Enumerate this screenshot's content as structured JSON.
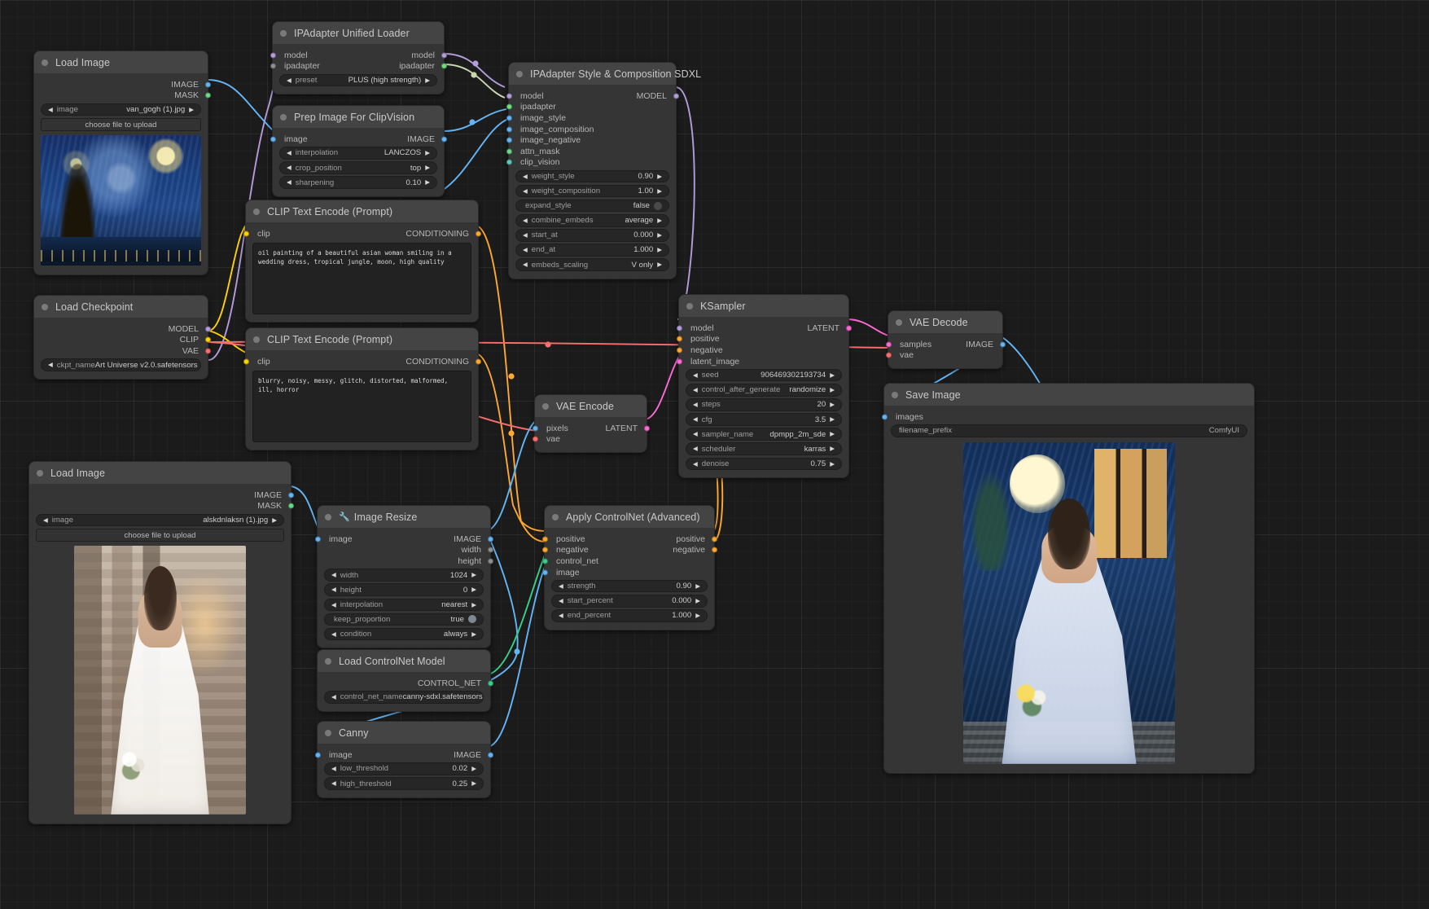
{
  "app": "ComfyUI node graph",
  "colors": {
    "node_bg": "#353535",
    "node_title_bg": "#444444",
    "link_model": "#b39ddb",
    "link_cond": "#ffa931",
    "link_image": "#64b5f6",
    "link_latent": "#ff6bd6",
    "link_vae": "#ff6e6e",
    "link_clip": "#ffd500",
    "link_controlnet": "#39d18a",
    "link_ipadapter": "#c9d6b0"
  },
  "nodes": {
    "load_image_style": {
      "title": "Load Image",
      "outputs": [
        "IMAGE",
        "MASK"
      ],
      "widgets": [
        {
          "name": "image",
          "value": "van_gogh (1).jpg",
          "arrows": true
        }
      ],
      "button": "choose file to upload",
      "preview_alt": "starry night style reference"
    },
    "ipadapter_loader": {
      "title": "IPAdapter Unified Loader",
      "inputs": [
        "model",
        "ipadapter"
      ],
      "outputs": [
        "model",
        "ipadapter"
      ],
      "widgets": [
        {
          "name": "preset",
          "value": "PLUS (high strength)",
          "arrows": true
        }
      ]
    },
    "prep_clipvision": {
      "title": "Prep Image For ClipVision",
      "inputs": [
        "image"
      ],
      "outputs": [
        "IMAGE"
      ],
      "widgets": [
        {
          "name": "interpolation",
          "value": "LANCZOS",
          "arrows": true
        },
        {
          "name": "crop_position",
          "value": "top",
          "arrows": true
        },
        {
          "name": "sharpening",
          "value": "0.10",
          "arrows": true
        }
      ]
    },
    "ipadapter_style_comp": {
      "title": "IPAdapter Style & Composition SDXL",
      "inputs": [
        "model",
        "ipadapter",
        "image_style",
        "image_composition",
        "image_negative",
        "attn_mask",
        "clip_vision"
      ],
      "outputs": [
        "MODEL"
      ],
      "widgets": [
        {
          "name": "weight_style",
          "value": "0.90",
          "arrows": true
        },
        {
          "name": "weight_composition",
          "value": "1.00",
          "arrows": true
        },
        {
          "name": "expand_style",
          "value": "false",
          "arrows": false,
          "toggle": true
        },
        {
          "name": "combine_embeds",
          "value": "average",
          "arrows": true
        },
        {
          "name": "start_at",
          "value": "0.000",
          "arrows": true
        },
        {
          "name": "end_at",
          "value": "1.000",
          "arrows": true
        },
        {
          "name": "embeds_scaling",
          "value": "V only",
          "arrows": true
        }
      ]
    },
    "clip_positive": {
      "title": "CLIP Text Encode (Prompt)",
      "inputs": [
        "clip"
      ],
      "outputs": [
        "CONDITIONING"
      ],
      "text": "oil painting of a beautiful asian woman smiling in a wedding dress, tropical jungle, moon, high quality"
    },
    "clip_negative": {
      "title": "CLIP Text Encode (Prompt)",
      "inputs": [
        "clip"
      ],
      "outputs": [
        "CONDITIONING"
      ],
      "text": "blurry, noisy, messy, glitch, distorted, malformed, ill, horror"
    },
    "load_checkpoint": {
      "title": "Load Checkpoint",
      "outputs": [
        "MODEL",
        "CLIP",
        "VAE"
      ],
      "widgets": [
        {
          "name": "ckpt_name",
          "value": "Art Universe v2.0.safetensors",
          "arrows": true
        }
      ]
    },
    "load_image_subject": {
      "title": "Load Image",
      "outputs": [
        "IMAGE",
        "MASK"
      ],
      "widgets": [
        {
          "name": "image",
          "value": "alskdnlaksn (1).jpg",
          "arrows": true
        }
      ],
      "button": "choose file to upload",
      "preview_alt": "bride photo reference"
    },
    "image_resize": {
      "title": "Image Resize",
      "icon": "wrench-icon",
      "inputs": [
        "image"
      ],
      "outputs": [
        "IMAGE",
        "width",
        "height"
      ],
      "widgets": [
        {
          "name": "width",
          "value": "1024",
          "arrows": true
        },
        {
          "name": "height",
          "value": "0",
          "arrows": true
        },
        {
          "name": "interpolation",
          "value": "nearest",
          "arrows": true
        },
        {
          "name": "keep_proportion",
          "value": "true",
          "arrows": false,
          "toggle": true
        },
        {
          "name": "condition",
          "value": "always",
          "arrows": true
        }
      ]
    },
    "vae_encode": {
      "title": "VAE Encode",
      "inputs": [
        "pixels",
        "vae"
      ],
      "outputs": [
        "LATENT"
      ]
    },
    "apply_controlnet": {
      "title": "Apply ControlNet (Advanced)",
      "inputs": [
        "positive",
        "negative",
        "control_net",
        "image"
      ],
      "outputs": [
        "positive",
        "negative"
      ],
      "widgets": [
        {
          "name": "strength",
          "value": "0.90",
          "arrows": true
        },
        {
          "name": "start_percent",
          "value": "0.000",
          "arrows": true
        },
        {
          "name": "end_percent",
          "value": "1.000",
          "arrows": true
        }
      ]
    },
    "load_controlnet": {
      "title": "Load ControlNet Model",
      "outputs": [
        "CONTROL_NET"
      ],
      "widgets": [
        {
          "name": "control_net_name",
          "value": "canny-sdxl.safetensors",
          "arrows": true
        }
      ]
    },
    "canny": {
      "title": "Canny",
      "inputs": [
        "image"
      ],
      "outputs": [
        "IMAGE"
      ],
      "widgets": [
        {
          "name": "low_threshold",
          "value": "0.02",
          "arrows": true
        },
        {
          "name": "high_threshold",
          "value": "0.25",
          "arrows": true
        }
      ]
    },
    "ksampler": {
      "title": "KSampler",
      "inputs": [
        "model",
        "positive",
        "negative",
        "latent_image"
      ],
      "outputs": [
        "LATENT"
      ],
      "widgets": [
        {
          "name": "seed",
          "value": "906469302193734",
          "arrows": true
        },
        {
          "name": "control_after_generate",
          "value": "randomize",
          "arrows": true
        },
        {
          "name": "steps",
          "value": "20",
          "arrows": true
        },
        {
          "name": "cfg",
          "value": "3.5",
          "arrows": true
        },
        {
          "name": "sampler_name",
          "value": "dpmpp_2m_sde",
          "arrows": true
        },
        {
          "name": "scheduler",
          "value": "karras",
          "arrows": true
        },
        {
          "name": "denoise",
          "value": "0.75",
          "arrows": true
        }
      ]
    },
    "vae_decode": {
      "title": "VAE Decode",
      "inputs": [
        "samples",
        "vae"
      ],
      "outputs": [
        "IMAGE"
      ]
    },
    "save_image": {
      "title": "Save Image",
      "inputs": [
        "images"
      ],
      "widgets": [
        {
          "name": "filename_prefix",
          "value": "ComfyUI",
          "arrows": false
        }
      ],
      "preview_alt": "generated painted bride result"
    }
  }
}
